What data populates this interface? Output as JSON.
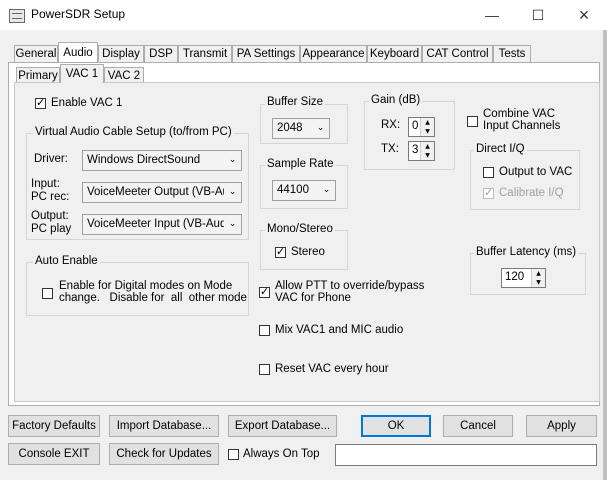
{
  "window": {
    "title": "PowerSDR Setup",
    "minimize_icon": "minimize-icon",
    "maximize_icon": "maximize-icon",
    "close_icon": "close-icon"
  },
  "tabs": [
    "General",
    "Audio",
    "Display",
    "DSP",
    "Transmit",
    "PA Settings",
    "Appearance",
    "Keyboard",
    "CAT Control",
    "Tests"
  ],
  "selected_tab": "Audio",
  "subtabs": [
    "Primary",
    "VAC 1",
    "VAC 2"
  ],
  "selected_subtab": "VAC 1",
  "vac1": {
    "enable_label": "Enable VAC 1",
    "enable_checked": true,
    "vac_setup_title": "Virtual Audio Cable Setup (to/from PC)",
    "driver_label": "Driver:",
    "driver_value": "Windows DirectSound",
    "input_label_1": "Input:",
    "input_label_2": "PC rec:",
    "input_value": "VoiceMeeter Output (VB-Auc",
    "output_label_1": "Output:",
    "output_label_2": "PC play",
    "output_value": "VoiceMeeter Input (VB-Audic",
    "auto_enable_title": "Auto Enable",
    "auto_enable_line1": "Enable for Digital modes on Mode",
    "auto_enable_line2": "change.   Disable for  all  other mode",
    "auto_enable_checked": false
  },
  "buffer_size": {
    "title": "Buffer Size",
    "value": "2048"
  },
  "sample_rate": {
    "title": "Sample Rate",
    "value": "44100"
  },
  "mono_stereo": {
    "title": "Mono/Stereo",
    "stereo_label": "Stereo",
    "stereo_checked": true
  },
  "gain": {
    "title": "Gain (dB)",
    "rx_label": "RX:",
    "rx_value": "0",
    "tx_label": "TX:",
    "tx_value": "3"
  },
  "combine": {
    "line1": "Combine VAC",
    "line2": "Input Channels",
    "checked": false
  },
  "direct_iq": {
    "title": "Direct I/Q",
    "output_label": "Output to VAC",
    "output_checked": false,
    "calibrate_label": "Calibrate I/Q",
    "calibrate_checked": true
  },
  "buffer_latency": {
    "title": "Buffer Latency (ms)",
    "value": "120"
  },
  "allow_ptt": {
    "line1": "Allow PTT to override/bypass",
    "line2": "VAC for Phone",
    "checked": true
  },
  "mix_vac": {
    "label": "Mix VAC1 and MIC audio",
    "checked": false
  },
  "reset_vac": {
    "label": "Reset VAC every hour",
    "checked": false
  },
  "buttons": {
    "factory_defaults": "Factory Defaults",
    "import_database": "Import Database...",
    "export_database": "Export Database...",
    "ok": "OK",
    "cancel": "Cancel",
    "apply": "Apply",
    "console_exit": "Console EXIT",
    "check_updates": "Check for Updates",
    "always_on_top": "Always On Top"
  },
  "always_on_top_checked": false,
  "colors": {
    "accent": "#0078d7",
    "panel": "#f0f0f0",
    "border": "#adadad"
  }
}
